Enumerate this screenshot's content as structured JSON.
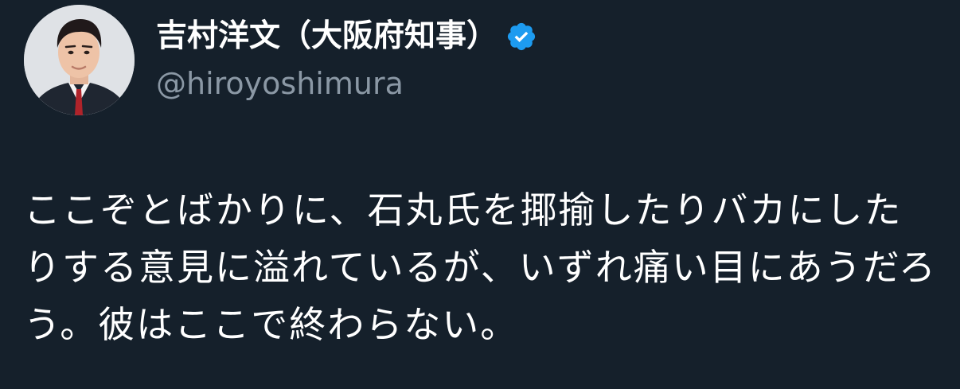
{
  "author": {
    "display_name": "吉村洋文（大阪府知事）",
    "handle": "@hiroyoshimura",
    "verified_icon": "verified-badge-icon",
    "avatar": "profile-photo"
  },
  "tweet": {
    "text": "ここぞとばかりに、石丸氏を揶揄したりバカにしたりする意見に溢れているが、いずれ痛い目にあうだろう。彼はここで終わらない。"
  },
  "colors": {
    "background": "#15202b",
    "text_primary": "#ffffff",
    "text_secondary": "#8b98a5",
    "verified_blue": "#1d9bf0"
  }
}
